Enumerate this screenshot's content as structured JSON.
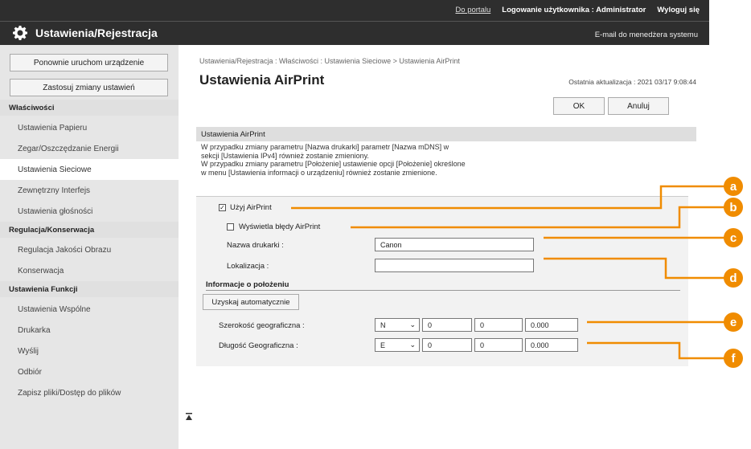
{
  "header": {
    "portal_link": "Do portalu",
    "login_user": "Logowanie użytkownika : Administrator",
    "logout": "Wyloguj się",
    "app_title": "Ustawienia/Rejestracja",
    "admin_email": "E-mail do menedżera systemu"
  },
  "sidebar": {
    "restart_button": "Ponownie uruchom urządzenie",
    "apply_button": "Zastosuj zmiany ustawień",
    "sections": [
      {
        "title": "Właściwości",
        "items": [
          "Ustawienia Papieru",
          "Zegar/Oszczędzanie Energii",
          "Ustawienia Sieciowe",
          "Zewnętrzny Interfejs",
          "Ustawienia głośności"
        ]
      },
      {
        "title": "Regulacja/Konserwacja",
        "items": [
          "Regulacja Jakości Obrazu",
          "Konserwacja"
        ]
      },
      {
        "title": "Ustawienia Funkcji",
        "items": [
          "Ustawienia Wspólne",
          "Drukarka",
          "Wyślij",
          "Odbiór",
          "Zapisz pliki/Dostęp do plików"
        ]
      }
    ],
    "selected_item": "Ustawienia Sieciowe"
  },
  "main": {
    "breadcrumb": "Ustawienia/Rejestracja : Właściwości : Ustawienia Sieciowe > Ustawienia AirPrint",
    "title": "Ustawienia AirPrint",
    "last_updated": "Ostatnia aktualizacja : 2021 03/17 9:08:44",
    "ok_button": "OK",
    "cancel_button": "Anuluj",
    "section_title": "Ustawienia AirPrint",
    "description": [
      "W przypadku zmiany parametru [Nazwa drukarki] parametr [Nazwa mDNS] w",
      "sekcji [Ustawienia IPv4] również zostanie zmieniony.",
      "W przypadku zmiany parametru [Położenie] ustawienie opcji [Położenie] określone",
      "w menu [Ustawienia informacji o urządzeniu] również zostanie zmienione."
    ],
    "use_airprint": {
      "label": "Użyj AirPrint",
      "checked": true
    },
    "show_errors": {
      "label": "Wyświetla błędy AirPrint",
      "checked": false
    },
    "printer_name": {
      "label": "Nazwa drukarki :",
      "value": "Canon"
    },
    "location": {
      "label": "Lokalizacja :",
      "value": ""
    },
    "position_info_title": "Informacje o położeniu",
    "auto_acquire_button": "Uzyskaj automatycznie",
    "latitude": {
      "label": "Szerokość geograficzna :",
      "dir": "N",
      "deg": "0",
      "min": "0",
      "sec": "0.000"
    },
    "longitude": {
      "label": "Długość Geograficzna :",
      "dir": "E",
      "deg": "0",
      "min": "0",
      "sec": "0.000"
    }
  },
  "callouts": [
    "a",
    "b",
    "c",
    "d",
    "e",
    "f"
  ],
  "accent_color": "#f08c00"
}
